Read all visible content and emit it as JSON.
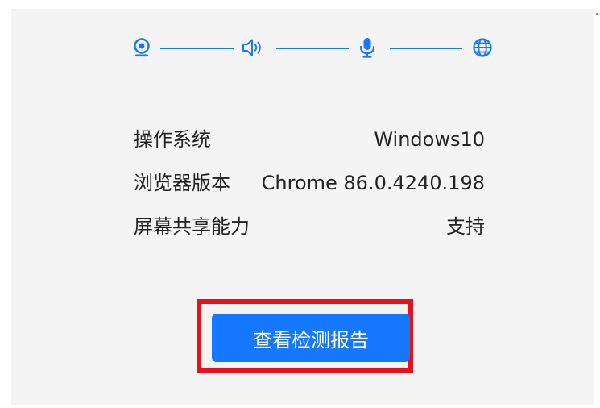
{
  "steps": [
    {
      "icon": "camera-icon"
    },
    {
      "icon": "speaker-icon"
    },
    {
      "icon": "microphone-icon"
    },
    {
      "icon": "globe-icon"
    }
  ],
  "colors": {
    "accent": "#1677ff",
    "highlight": "#e8111b",
    "panel": "#f4f4f4"
  },
  "info": [
    {
      "label": "操作系统",
      "value": "Windows10"
    },
    {
      "label": "浏览器版本",
      "value": "Chrome 86.0.4240.198"
    },
    {
      "label": "屏幕共享能力",
      "value": "支持"
    }
  ],
  "report_button": {
    "label": "查看检测报告"
  }
}
